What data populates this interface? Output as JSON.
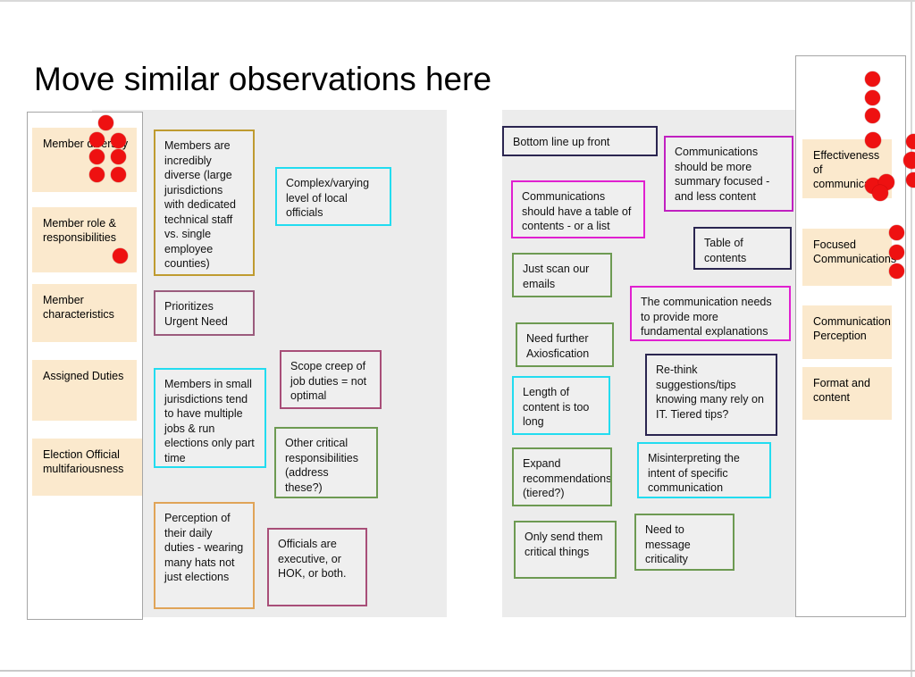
{
  "page": {
    "title": "Move similar observations here",
    "background": "#ffffff",
    "board_color": "#ececec",
    "category_color": "#fbe9cd",
    "note_fill": "#efefef",
    "dot_color": "#ee1111"
  },
  "left_group": {
    "categories": [
      {
        "label": "Member diversity"
      },
      {
        "label": "Member role & responsibilities"
      },
      {
        "label": "Member characteristics"
      },
      {
        "label": "Assigned Duties"
      },
      {
        "label": "Election Official multifariousness"
      }
    ],
    "notes": [
      {
        "text": "Members are incredibly diverse (large jurisdictions with dedicated technical staff vs. single employee counties)",
        "border": "#bf9b30"
      },
      {
        "text": "Complex/varying level of local officials",
        "border": "#22dcf0"
      },
      {
        "text": "Prioritizes Urgent Need",
        "border": "#9b5b7d"
      },
      {
        "text": "Members in small jurisdictions tend to have multiple jobs & run elections only part time",
        "border": "#22dcf0"
      },
      {
        "text": "Scope creep of job duties = not optimal",
        "border": "#a84e78"
      },
      {
        "text": "Other critical responsibilities (address these?)",
        "border": "#6d9a52"
      },
      {
        "text": "Perception of their daily duties - wearing many hats not just elections",
        "border": "#e0a458"
      },
      {
        "text": "Officials are executive, or HOK, or both.",
        "border": "#a84e78"
      }
    ],
    "dot_counts": {
      "member_diversity": 7,
      "member_role": 1
    }
  },
  "right_group": {
    "categories": [
      {
        "label": "Effectiveness of communications"
      },
      {
        "label": "Focused Communications"
      },
      {
        "label": "Communication Perception"
      },
      {
        "label": "Format and content"
      }
    ],
    "notes": [
      {
        "text": "Bottom line up front",
        "border": "#2a2550"
      },
      {
        "text": "Communications should have a table of contents - or a list",
        "border": "#e020d0"
      },
      {
        "text": "Just scan our emails",
        "border": "#6d9a52"
      },
      {
        "text": "Need further Axiosfication",
        "border": "#6d9a52"
      },
      {
        "text": "Length of content is too long",
        "border": "#22dcf0"
      },
      {
        "text": "Expand recommendations (tiered?)",
        "border": "#6d9a52"
      },
      {
        "text": "Only send them critical things",
        "border": "#6d9a52"
      },
      {
        "text": "Communications should be more summary focused - and less content",
        "border": "#c020c0"
      },
      {
        "text": "Table of contents",
        "border": "#2a2550"
      },
      {
        "text": "The communication needs to provide more fundamental explanations",
        "border": "#e020d0"
      },
      {
        "text": "Re-think suggestions/tips knowing many rely on IT. Tiered tips?",
        "border": "#2a2550"
      },
      {
        "text": "Misinterpreting the intent of specific communication",
        "border": "#22dcf0"
      },
      {
        "text": "Need to message criticality",
        "border": "#6d9a52"
      }
    ],
    "dot_counts": {
      "effectiveness": 8,
      "focused": 3,
      "offboard": 3
    }
  }
}
